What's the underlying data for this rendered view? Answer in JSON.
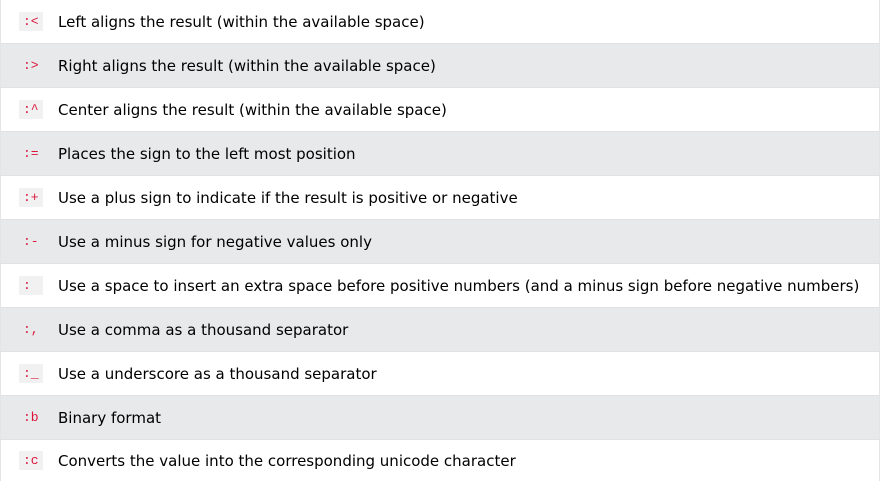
{
  "rows": [
    {
      "code": ":<",
      "description": "Left aligns the result (within the available space)"
    },
    {
      "code": ":>",
      "description": "Right aligns the result (within the available space)"
    },
    {
      "code": ":^",
      "description": "Center aligns the result (within the available space)"
    },
    {
      "code": ":=",
      "description": "Places the sign to the left most position"
    },
    {
      "code": ":+",
      "description": "Use a plus sign to indicate if the result is positive or negative"
    },
    {
      "code": ":-",
      "description": "Use a minus sign for negative values only"
    },
    {
      "code": ": ",
      "description": "Use a space to insert an extra space before positive numbers (and a minus sign before negative numbers)"
    },
    {
      "code": ":,",
      "description": "Use a comma as a thousand separator"
    },
    {
      "code": ":_",
      "description": "Use a underscore as a thousand separator"
    },
    {
      "code": ":b",
      "description": "Binary format"
    },
    {
      "code": ":c",
      "description": "Converts the value into the corresponding unicode character"
    }
  ],
  "colors": {
    "code_text": "#dc143c",
    "alt_row_bg": "#e8e9eb",
    "row_bg": "#ffffff"
  }
}
